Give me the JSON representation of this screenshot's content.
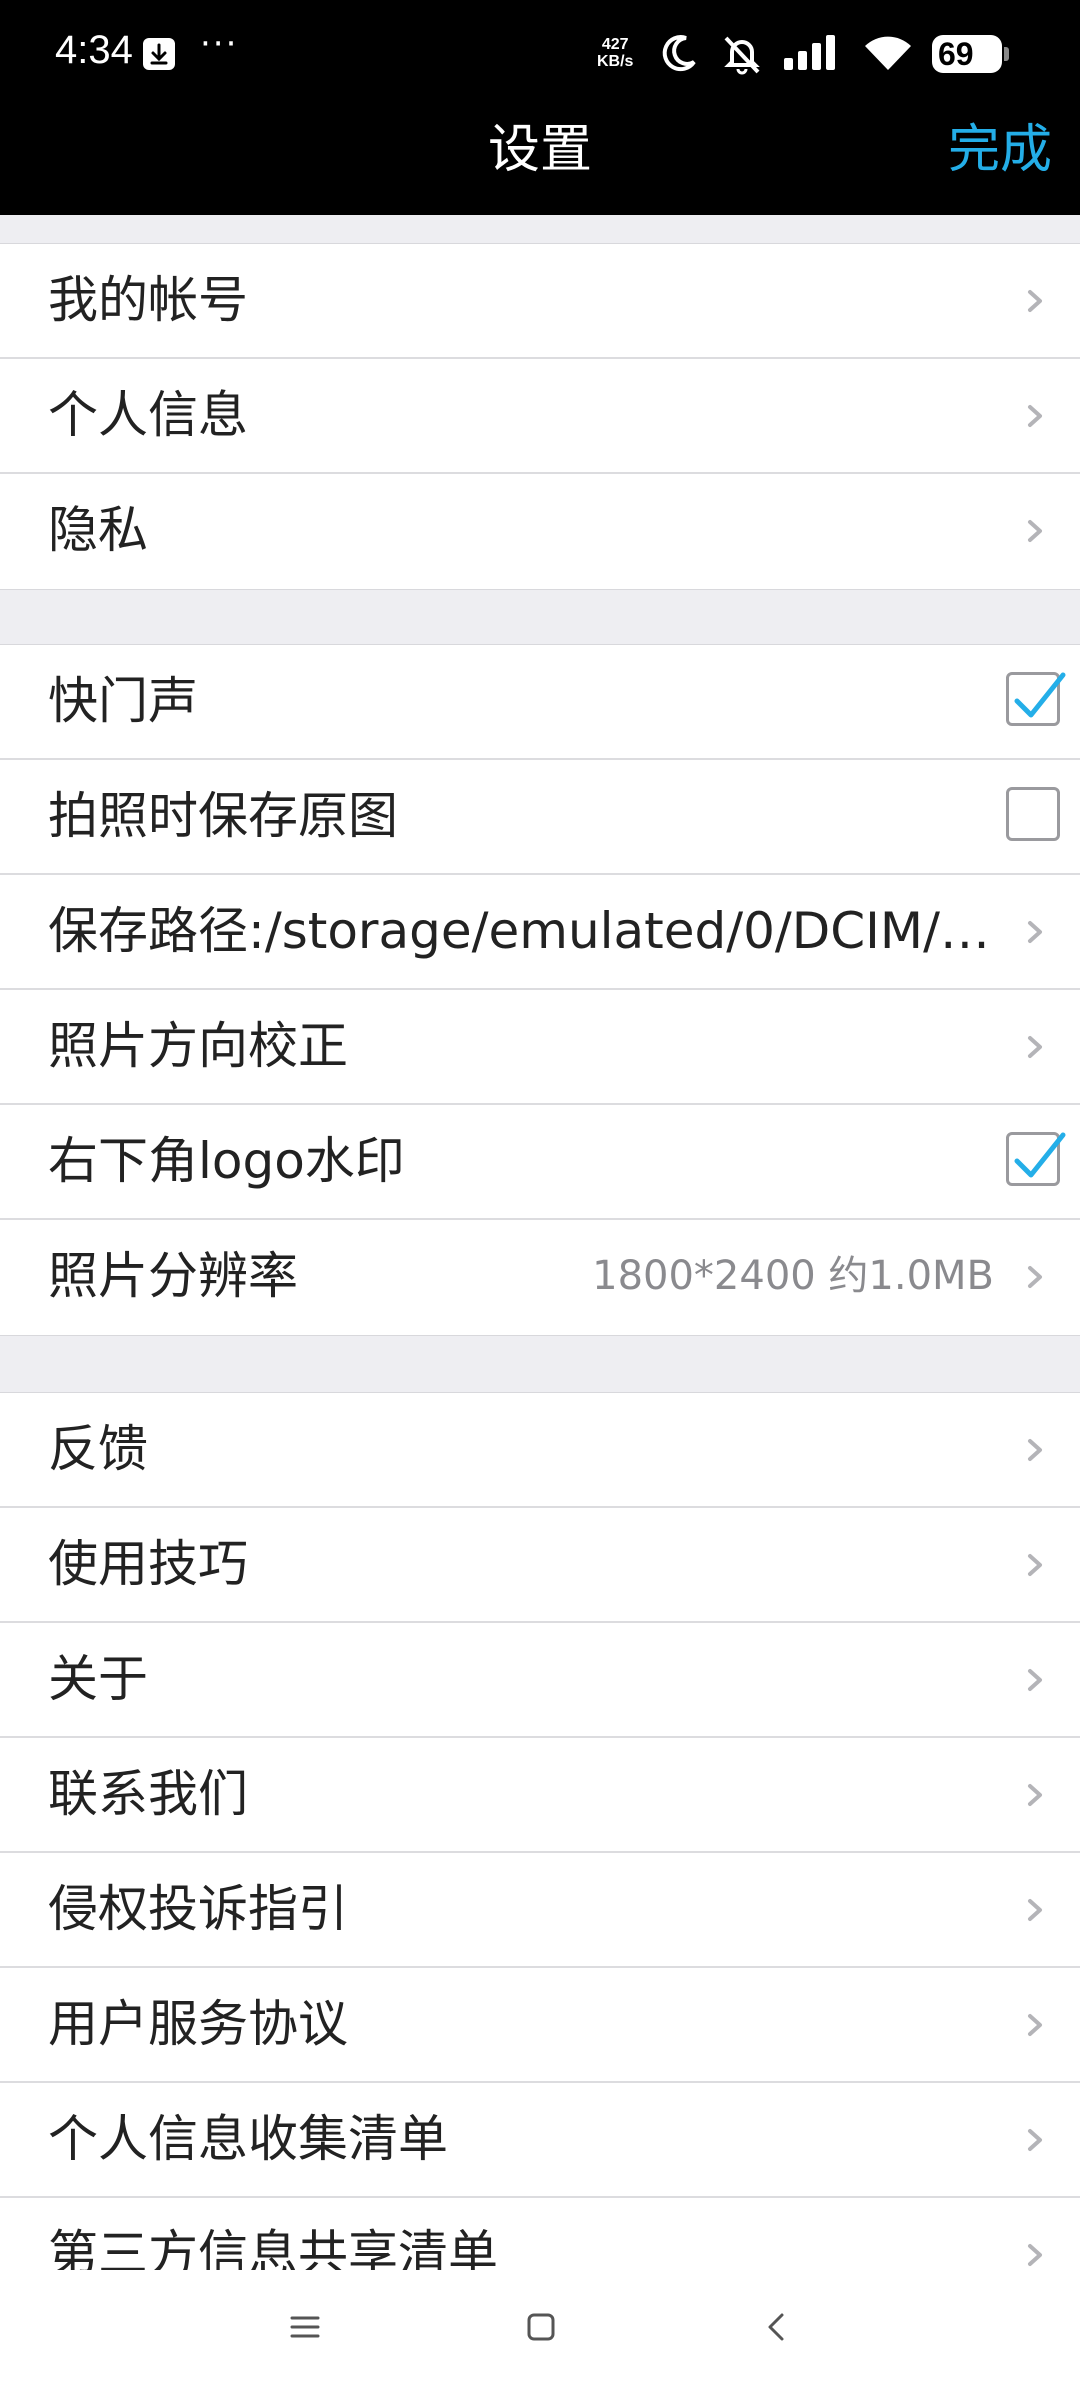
{
  "status_bar": {
    "time": "4:34",
    "more": "···",
    "net_speed_value": "427",
    "net_speed_unit": "KB/s",
    "battery": "69",
    "icons": [
      "download-icon",
      "moon-icon",
      "bell-off-icon",
      "signal-icon",
      "wifi-icon",
      "battery-icon"
    ]
  },
  "nav": {
    "title": "设置",
    "done": "完成"
  },
  "sections": [
    {
      "items": [
        {
          "label": "我的帐号",
          "type": "link"
        },
        {
          "label": "个人信息",
          "type": "link"
        },
        {
          "label": "隐私",
          "type": "link"
        }
      ]
    },
    {
      "items": [
        {
          "label": "快门声",
          "type": "checkbox",
          "checked": true
        },
        {
          "label": "拍照时保存原图",
          "type": "checkbox",
          "checked": false
        },
        {
          "label": "保存路径:/storage/emulated/0/DCIM/Ca...",
          "type": "link"
        },
        {
          "label": "照片方向校正",
          "type": "link"
        },
        {
          "label": "右下角logo水印",
          "type": "checkbox",
          "checked": true
        },
        {
          "label": "照片分辨率",
          "value": "1800*2400 约1.0MB",
          "type": "link"
        }
      ]
    },
    {
      "items": [
        {
          "label": "反馈",
          "type": "link"
        },
        {
          "label": "使用技巧",
          "type": "link"
        },
        {
          "label": "关于",
          "type": "link"
        },
        {
          "label": "联系我们",
          "type": "link"
        },
        {
          "label": "侵权投诉指引",
          "type": "link"
        },
        {
          "label": "用户服务协议",
          "type": "link"
        },
        {
          "label": "个人信息收集清单",
          "type": "link"
        },
        {
          "label": "第三方信息共享清单",
          "type": "link"
        }
      ]
    }
  ],
  "colors": {
    "accent": "#24aee8",
    "bar_background": "#000000",
    "page_background": "#eeeef2"
  },
  "system_nav": [
    "menu-icon",
    "home-icon",
    "back-icon"
  ]
}
